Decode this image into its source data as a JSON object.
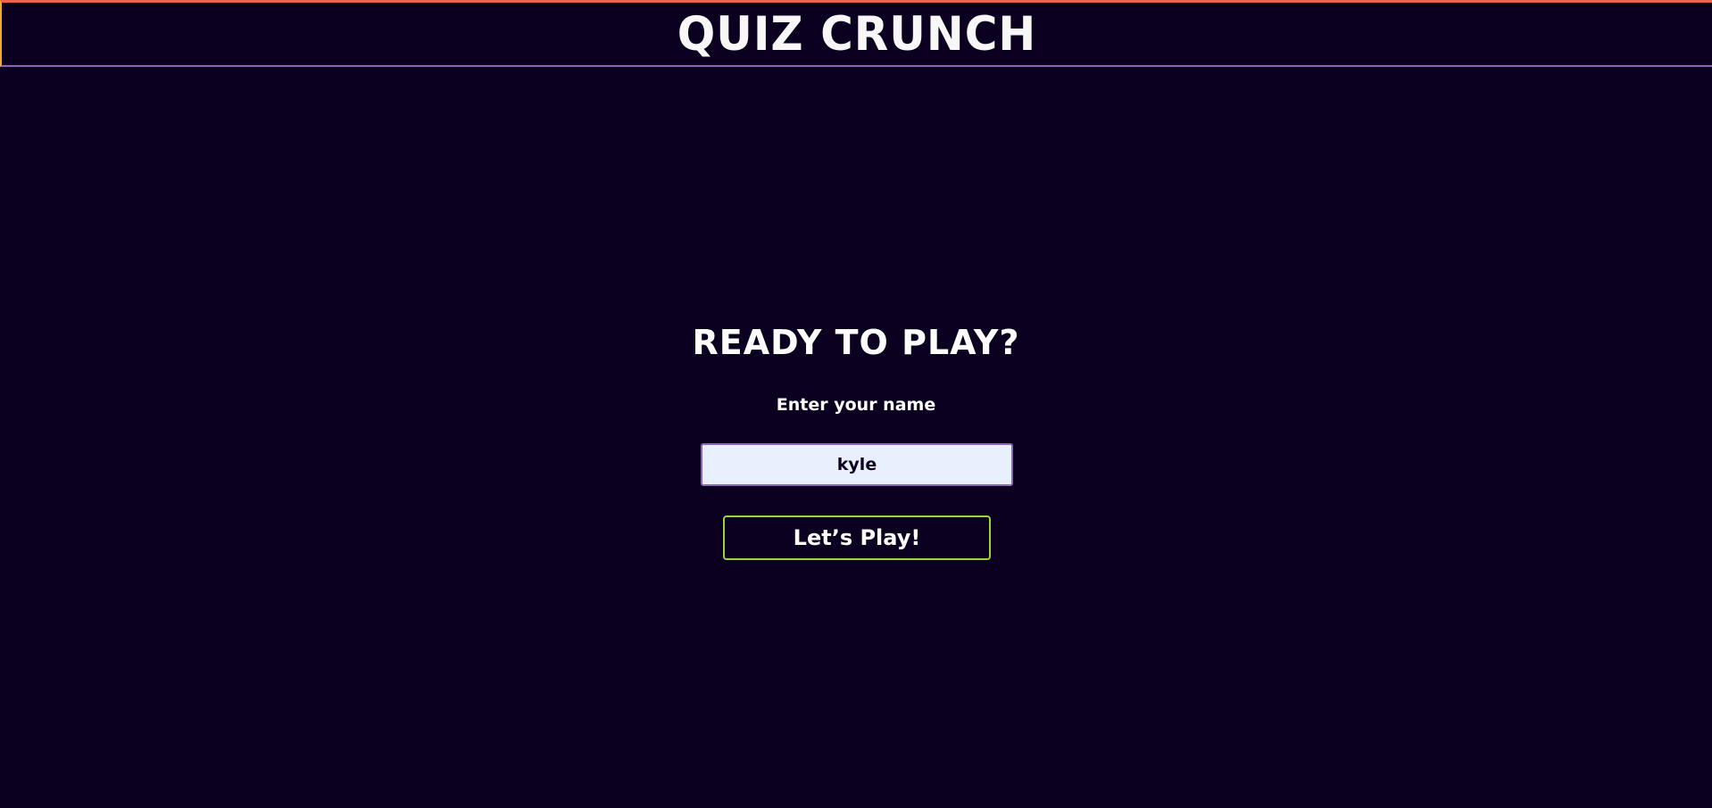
{
  "app": {
    "title": "QUIZ CRUNCH"
  },
  "start_screen": {
    "heading": "READY TO PLAY?",
    "name_label": "Enter your name",
    "name_value": "kyle",
    "play_button_label": "Let’s Play!"
  },
  "colors": {
    "background": "#0b0020",
    "header_top_border": "#e6684e",
    "header_bottom_border": "#8d68b8",
    "input_background": "#e8f0fe",
    "input_border": "#8d68b8",
    "button_border": "#9bd53a",
    "text": "#ffffff"
  }
}
